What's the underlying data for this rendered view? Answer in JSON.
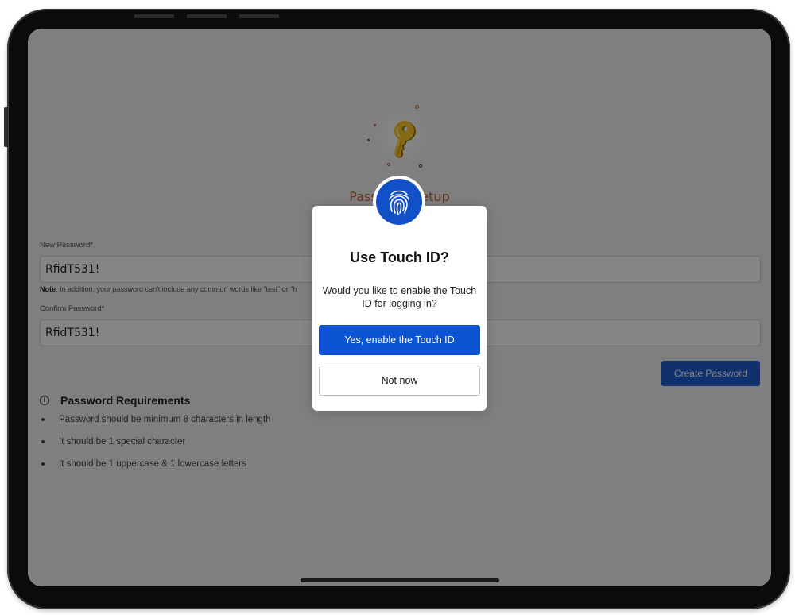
{
  "page": {
    "title": "Password Setup",
    "new_password": {
      "label": "New Password",
      "required_mark": "*",
      "value": "RfidT531!"
    },
    "note": {
      "prefix": "Note",
      "text": ": In addition, your password can't include any common words like \"test\" or \"h"
    },
    "confirm_password": {
      "label": "Confirm Password",
      "required_mark": "*",
      "value": "RfidT531!"
    },
    "create_button": "Create Password",
    "requirements": {
      "title": "Password Requirements",
      "items": [
        "Password should be minimum 8 characters in length",
        "It should be 1 special character",
        "It should be 1 uppercase & 1 lowercase letters"
      ]
    }
  },
  "modal": {
    "icon": "fingerprint-icon",
    "title": "Use Touch ID?",
    "message": "Would you like to enable the Touch ID for logging in?",
    "primary_button": "Yes, enable the Touch ID",
    "secondary_button": "Not now"
  },
  "colors": {
    "accent": "#0b55d4",
    "title_orange": "#d1612f",
    "key": "#e0a41c"
  }
}
